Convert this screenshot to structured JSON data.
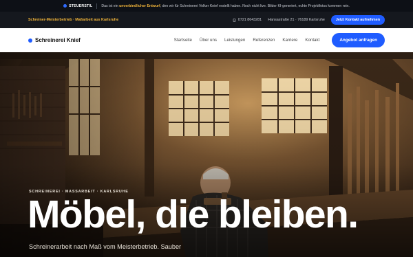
{
  "notice": {
    "brand": "STEUERSTIL",
    "text_before": "Das ist ein ",
    "highlight": "unverbindlicher Entwurf",
    "text_after": ", den wir für Schreinerei Volker Knief erstellt haben. Noch nicht live. Bilder KI-generiert, echte Projektfotos kommen rein."
  },
  "infobar": {
    "tagline": "Schreiner-Meisterbetrieb · Maßarbeit aus Karlsruhe",
    "phone": "0721 8643281",
    "address": "Hansastraße 21 · 76189 Karlsruhe",
    "contact_button": "Jetzt Kontakt aufnehmen"
  },
  "nav": {
    "logo": "Schreinerei Knief",
    "items": [
      "Startseite",
      "Über uns",
      "Leistungen",
      "Referenzen",
      "Karriere",
      "Kontakt"
    ],
    "cta": "Angebot anfragen"
  },
  "hero": {
    "eyebrow": "SCHREINEREI · MASSARBEIT · KARLSRUHE",
    "headline": "Möbel, die bleiben.",
    "subline": "Schreinerarbeit nach Maß vom Meisterbetrieb. Sauber"
  },
  "colors": {
    "accent": "#1f5cff",
    "highlight": "#f0b43a",
    "topbar": "#0d1016"
  }
}
